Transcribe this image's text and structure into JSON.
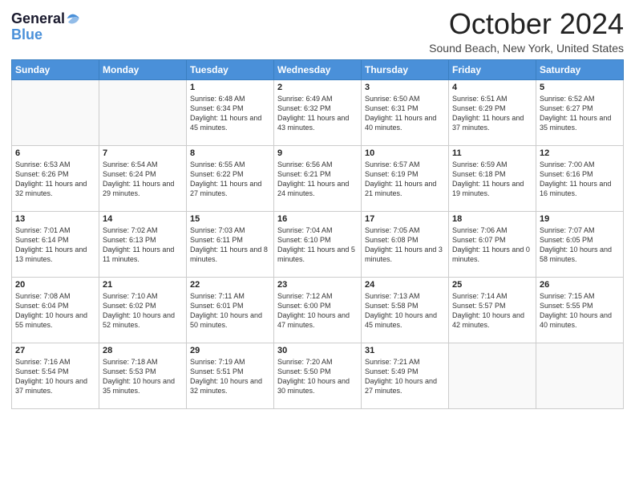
{
  "header": {
    "logo_line1": "General",
    "logo_line2": "Blue",
    "month": "October 2024",
    "location": "Sound Beach, New York, United States"
  },
  "weekdays": [
    "Sunday",
    "Monday",
    "Tuesday",
    "Wednesday",
    "Thursday",
    "Friday",
    "Saturday"
  ],
  "weeks": [
    [
      {
        "day": "",
        "info": ""
      },
      {
        "day": "",
        "info": ""
      },
      {
        "day": "1",
        "info": "Sunrise: 6:48 AM\nSunset: 6:34 PM\nDaylight: 11 hours and 45 minutes."
      },
      {
        "day": "2",
        "info": "Sunrise: 6:49 AM\nSunset: 6:32 PM\nDaylight: 11 hours and 43 minutes."
      },
      {
        "day": "3",
        "info": "Sunrise: 6:50 AM\nSunset: 6:31 PM\nDaylight: 11 hours and 40 minutes."
      },
      {
        "day": "4",
        "info": "Sunrise: 6:51 AM\nSunset: 6:29 PM\nDaylight: 11 hours and 37 minutes."
      },
      {
        "day": "5",
        "info": "Sunrise: 6:52 AM\nSunset: 6:27 PM\nDaylight: 11 hours and 35 minutes."
      }
    ],
    [
      {
        "day": "6",
        "info": "Sunrise: 6:53 AM\nSunset: 6:26 PM\nDaylight: 11 hours and 32 minutes."
      },
      {
        "day": "7",
        "info": "Sunrise: 6:54 AM\nSunset: 6:24 PM\nDaylight: 11 hours and 29 minutes."
      },
      {
        "day": "8",
        "info": "Sunrise: 6:55 AM\nSunset: 6:22 PM\nDaylight: 11 hours and 27 minutes."
      },
      {
        "day": "9",
        "info": "Sunrise: 6:56 AM\nSunset: 6:21 PM\nDaylight: 11 hours and 24 minutes."
      },
      {
        "day": "10",
        "info": "Sunrise: 6:57 AM\nSunset: 6:19 PM\nDaylight: 11 hours and 21 minutes."
      },
      {
        "day": "11",
        "info": "Sunrise: 6:59 AM\nSunset: 6:18 PM\nDaylight: 11 hours and 19 minutes."
      },
      {
        "day": "12",
        "info": "Sunrise: 7:00 AM\nSunset: 6:16 PM\nDaylight: 11 hours and 16 minutes."
      }
    ],
    [
      {
        "day": "13",
        "info": "Sunrise: 7:01 AM\nSunset: 6:14 PM\nDaylight: 11 hours and 13 minutes."
      },
      {
        "day": "14",
        "info": "Sunrise: 7:02 AM\nSunset: 6:13 PM\nDaylight: 11 hours and 11 minutes."
      },
      {
        "day": "15",
        "info": "Sunrise: 7:03 AM\nSunset: 6:11 PM\nDaylight: 11 hours and 8 minutes."
      },
      {
        "day": "16",
        "info": "Sunrise: 7:04 AM\nSunset: 6:10 PM\nDaylight: 11 hours and 5 minutes."
      },
      {
        "day": "17",
        "info": "Sunrise: 7:05 AM\nSunset: 6:08 PM\nDaylight: 11 hours and 3 minutes."
      },
      {
        "day": "18",
        "info": "Sunrise: 7:06 AM\nSunset: 6:07 PM\nDaylight: 11 hours and 0 minutes."
      },
      {
        "day": "19",
        "info": "Sunrise: 7:07 AM\nSunset: 6:05 PM\nDaylight: 10 hours and 58 minutes."
      }
    ],
    [
      {
        "day": "20",
        "info": "Sunrise: 7:08 AM\nSunset: 6:04 PM\nDaylight: 10 hours and 55 minutes."
      },
      {
        "day": "21",
        "info": "Sunrise: 7:10 AM\nSunset: 6:02 PM\nDaylight: 10 hours and 52 minutes."
      },
      {
        "day": "22",
        "info": "Sunrise: 7:11 AM\nSunset: 6:01 PM\nDaylight: 10 hours and 50 minutes."
      },
      {
        "day": "23",
        "info": "Sunrise: 7:12 AM\nSunset: 6:00 PM\nDaylight: 10 hours and 47 minutes."
      },
      {
        "day": "24",
        "info": "Sunrise: 7:13 AM\nSunset: 5:58 PM\nDaylight: 10 hours and 45 minutes."
      },
      {
        "day": "25",
        "info": "Sunrise: 7:14 AM\nSunset: 5:57 PM\nDaylight: 10 hours and 42 minutes."
      },
      {
        "day": "26",
        "info": "Sunrise: 7:15 AM\nSunset: 5:55 PM\nDaylight: 10 hours and 40 minutes."
      }
    ],
    [
      {
        "day": "27",
        "info": "Sunrise: 7:16 AM\nSunset: 5:54 PM\nDaylight: 10 hours and 37 minutes."
      },
      {
        "day": "28",
        "info": "Sunrise: 7:18 AM\nSunset: 5:53 PM\nDaylight: 10 hours and 35 minutes."
      },
      {
        "day": "29",
        "info": "Sunrise: 7:19 AM\nSunset: 5:51 PM\nDaylight: 10 hours and 32 minutes."
      },
      {
        "day": "30",
        "info": "Sunrise: 7:20 AM\nSunset: 5:50 PM\nDaylight: 10 hours and 30 minutes."
      },
      {
        "day": "31",
        "info": "Sunrise: 7:21 AM\nSunset: 5:49 PM\nDaylight: 10 hours and 27 minutes."
      },
      {
        "day": "",
        "info": ""
      },
      {
        "day": "",
        "info": ""
      }
    ]
  ]
}
